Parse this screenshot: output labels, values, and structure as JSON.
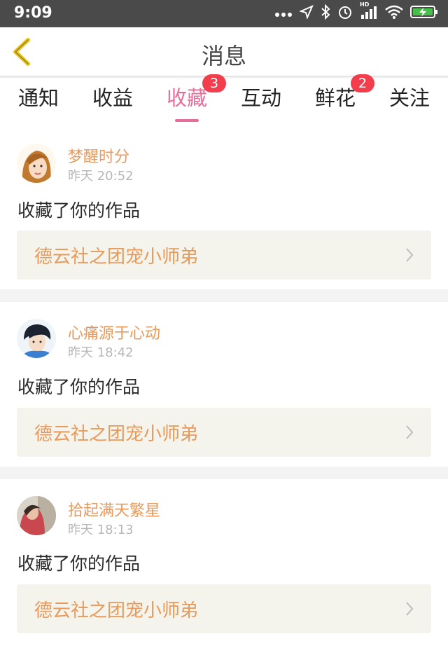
{
  "status_bar": {
    "time": "9:09",
    "hd_label": "HD"
  },
  "header": {
    "title": "消息"
  },
  "tabs": [
    {
      "label": "通知",
      "badge": ""
    },
    {
      "label": "收益",
      "badge": ""
    },
    {
      "label": "收藏",
      "badge": "3"
    },
    {
      "label": "互动",
      "badge": ""
    },
    {
      "label": "鲜花",
      "badge": "2"
    },
    {
      "label": "关注",
      "badge": ""
    }
  ],
  "active_tab": "收藏",
  "messages": [
    {
      "user": "梦醒时分",
      "time": "昨天 20:52",
      "text": "收藏了你的作品",
      "work": "德云社之团宠小师弟",
      "avatar_icon": "avatar-girl-cartoon"
    },
    {
      "user": "心痛源于心动",
      "time": "昨天 18:42",
      "text": "收藏了你的作品",
      "work": "德云社之团宠小师弟",
      "avatar_icon": "avatar-boy-photo"
    },
    {
      "user": "拾起满天繁星",
      "time": "昨天 18:13",
      "text": "收藏了你的作品",
      "work": "德云社之团宠小师弟",
      "avatar_icon": "avatar-girl-photo"
    }
  ],
  "colors": {
    "accent": "#e86e9a",
    "name": "#e79a5b",
    "badge": "#f23d4c",
    "back_arrow": "#e9c51e"
  }
}
